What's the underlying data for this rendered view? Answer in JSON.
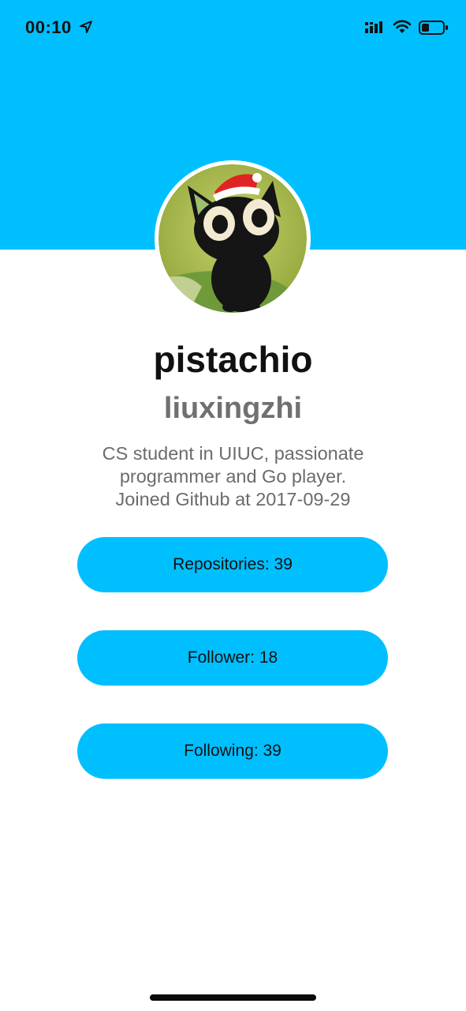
{
  "status_bar": {
    "time": "00:10",
    "icons": [
      "location-arrow-icon",
      "cellular-signal-icon",
      "wifi-icon",
      "battery-icon"
    ]
  },
  "profile": {
    "avatar_description": "cartoon-black-cat-with-santa-hat",
    "username": "pistachio",
    "realname": "liuxingzhi",
    "bio_lines": [
      "CS student in UIUC, passionate",
      "programmer and Go player.",
      "Joined Github at 2017-09-29"
    ]
  },
  "stats": {
    "repositories_label": "Repositories: 39",
    "follower_label": "Follower: 18",
    "following_label": "Following: 39"
  },
  "colors": {
    "accent": "#00bfff",
    "title_text": "#111111",
    "secondary_text": "#707070",
    "background": "#ffffff"
  }
}
